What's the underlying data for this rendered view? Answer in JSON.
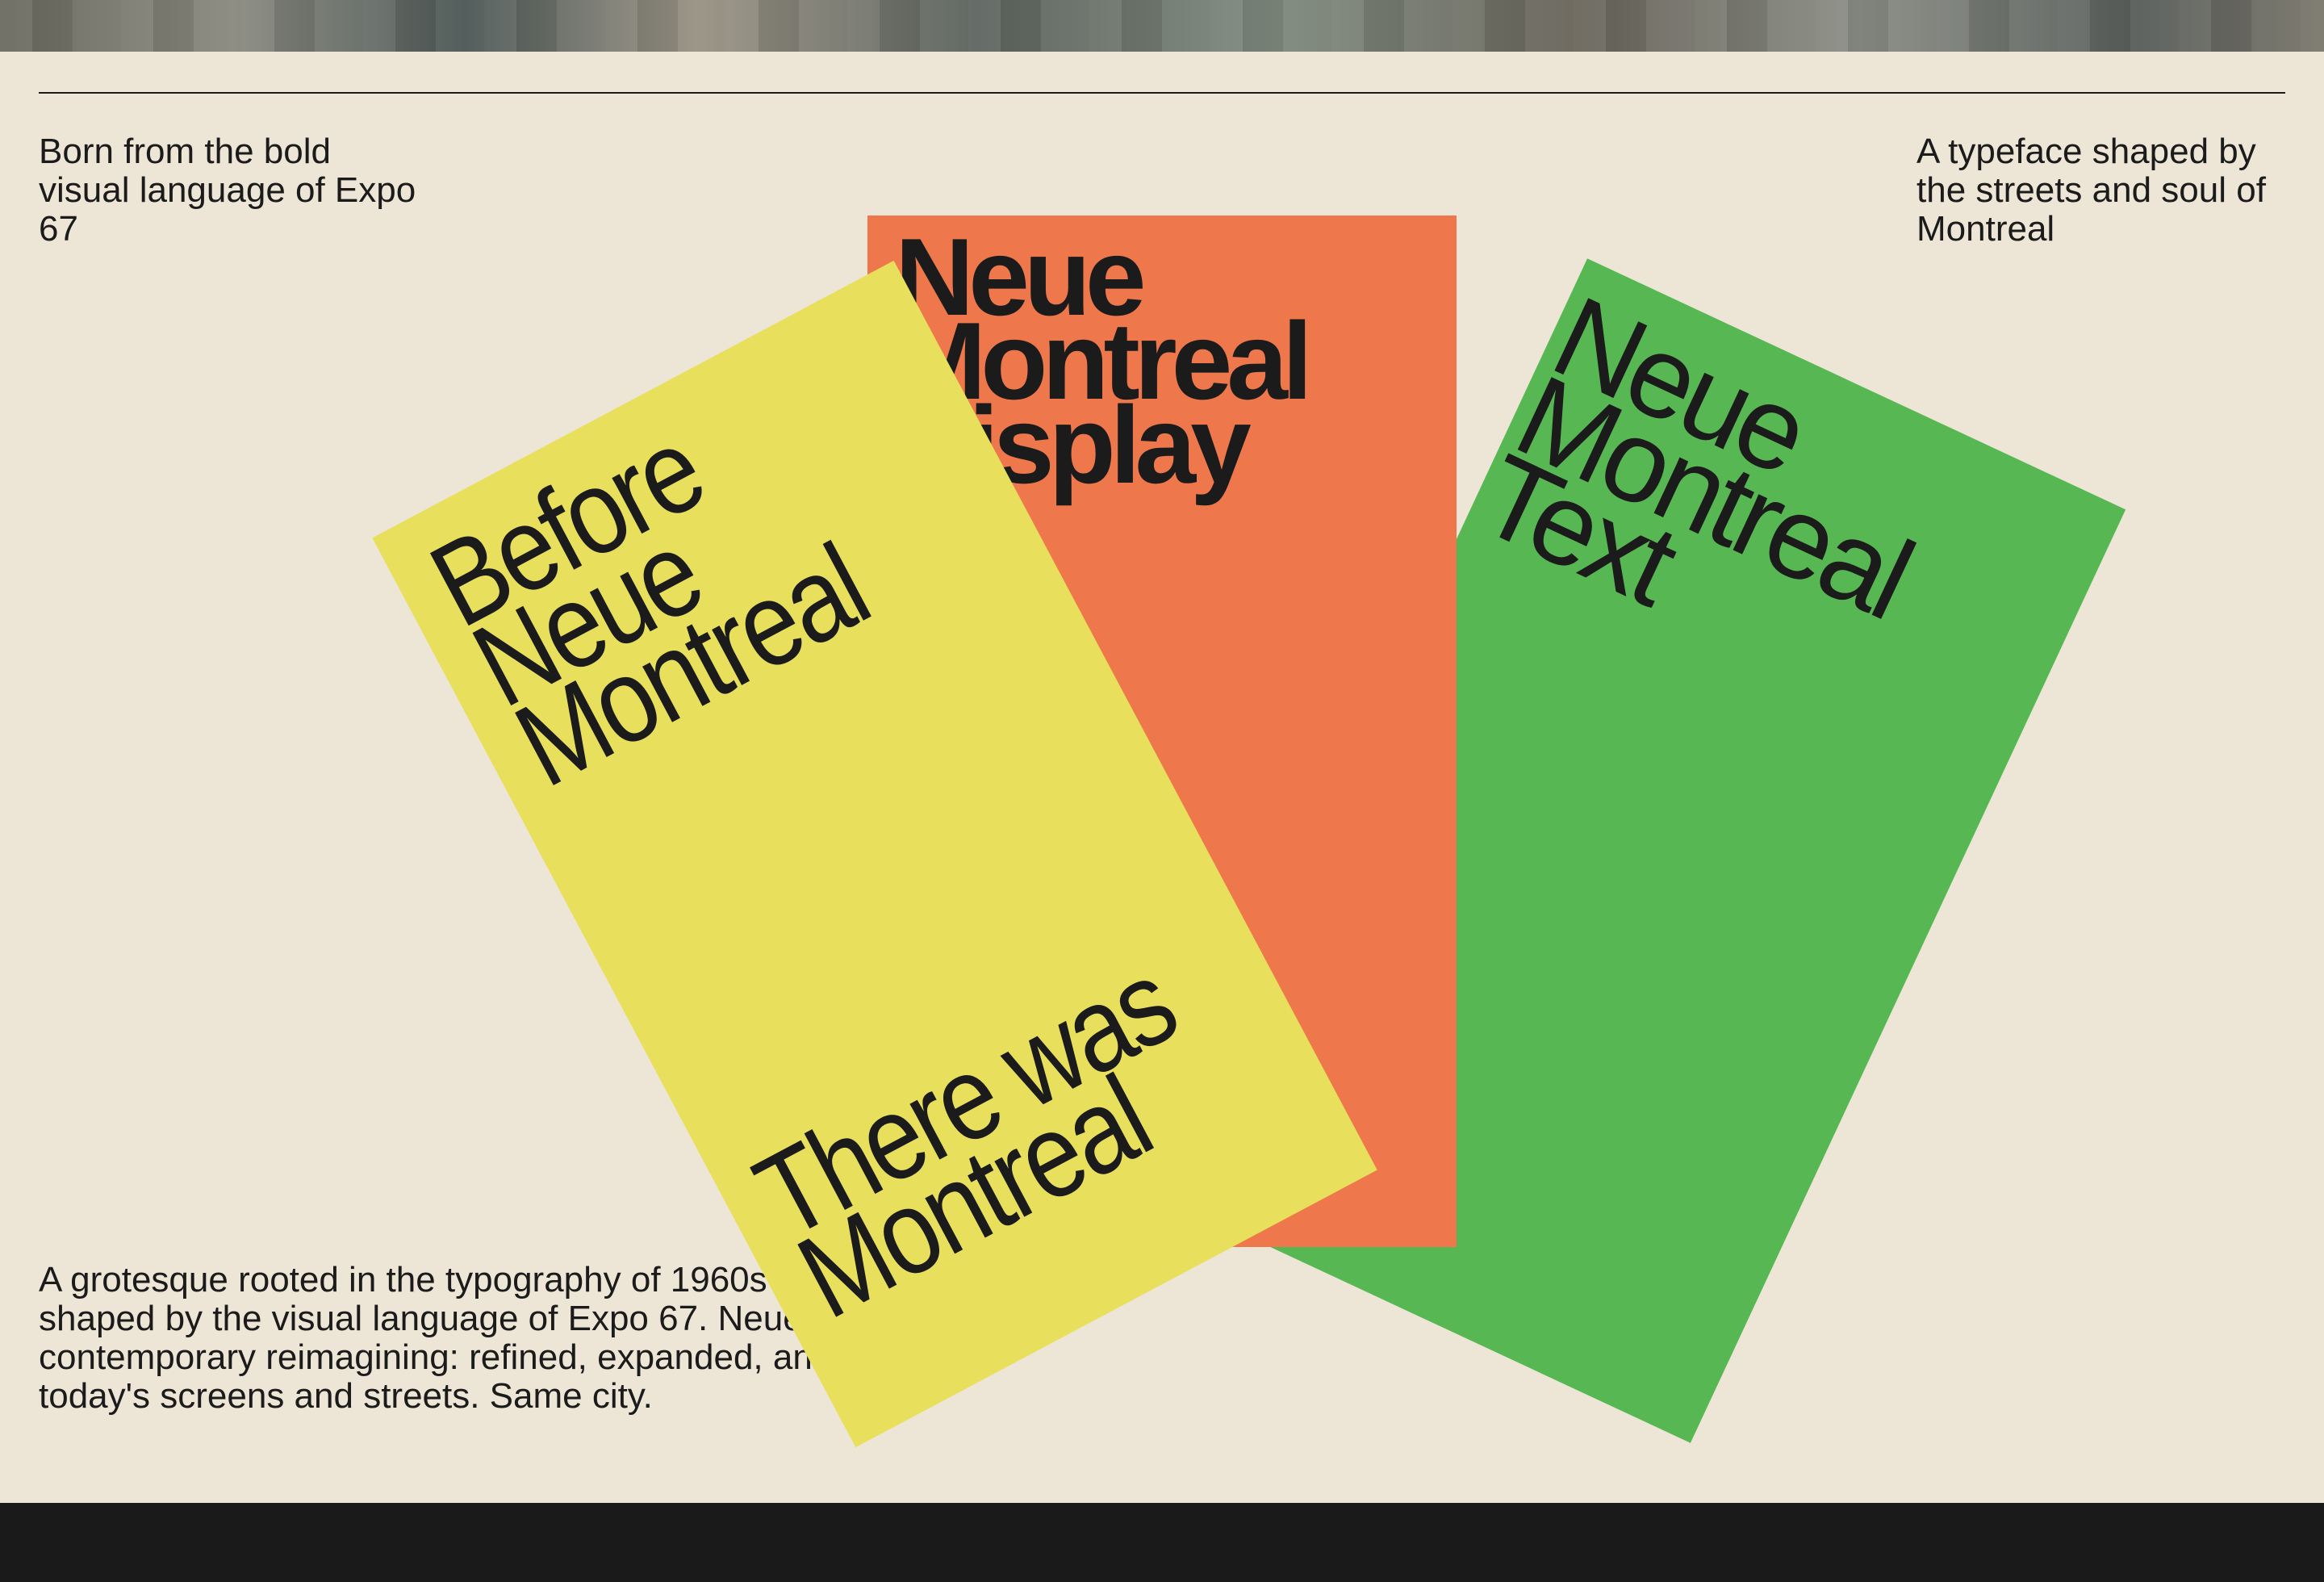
{
  "hero": {
    "letters": ""
  },
  "intro": {
    "left": "Born from the bold visual language of Expo 67",
    "right": "A typeface shaped by the streets and soul of Montreal"
  },
  "cards": {
    "yellow": {
      "top_text": "Before Neue Montreal",
      "bottom_text": "There was Montreal",
      "color": "#e8e05d"
    },
    "orange": {
      "text": "Neue Montreal Display",
      "color": "#ee774b"
    },
    "green": {
      "text": "Neue Montreal Text",
      "color": "#57b853"
    }
  },
  "description": "A grotesque rooted in the typography of 1960s modernism, shaped by the visual language of Expo 67. Neue Montreal is its contemporary reimagining: refined, expanded, and built for today's screens and streets. Same city.",
  "colors": {
    "background": "#ede6d6",
    "ink": "#1b1b1b",
    "footer": "#1a1a1a"
  }
}
